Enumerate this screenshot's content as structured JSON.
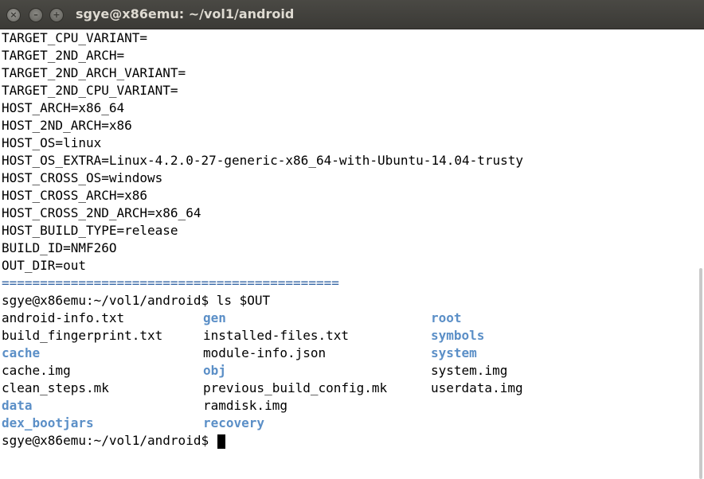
{
  "window": {
    "title": "sgye@x86emu: ~/vol1/android",
    "close_label": "×",
    "minimize_label": "–",
    "maximize_label": "+"
  },
  "terminal": {
    "env_lines": [
      "TARGET_CPU_VARIANT=",
      "TARGET_2ND_ARCH=",
      "TARGET_2ND_ARCH_VARIANT=",
      "TARGET_2ND_CPU_VARIANT=",
      "HOST_ARCH=x86_64",
      "HOST_2ND_ARCH=x86",
      "HOST_OS=linux",
      "HOST_OS_EXTRA=Linux-4.2.0-27-generic-x86_64-with-Ubuntu-14.04-trusty",
      "HOST_CROSS_OS=windows",
      "HOST_CROSS_ARCH=x86",
      "HOST_CROSS_2ND_ARCH=x86_64",
      "HOST_BUILD_TYPE=release",
      "BUILD_ID=NMF26O",
      "OUT_DIR=out"
    ],
    "separator": "============================================",
    "command_line": "sgye@x86emu:~/vol1/android$ ls $OUT",
    "listing": [
      [
        "android-info.txt",
        "gen",
        "root"
      ],
      [
        "build_fingerprint.txt",
        "installed-files.txt",
        "symbols"
      ],
      [
        "cache",
        "module-info.json",
        "system"
      ],
      [
        "cache.img",
        "obj",
        "system.img"
      ],
      [
        "clean_steps.mk",
        "previous_build_config.mk",
        "userdata.img"
      ],
      [
        "data",
        "ramdisk.img",
        ""
      ],
      [
        "dex_bootjars",
        "recovery",
        ""
      ]
    ],
    "listing_is_dir": [
      [
        false,
        true,
        true
      ],
      [
        false,
        false,
        true
      ],
      [
        true,
        false,
        true
      ],
      [
        false,
        true,
        false
      ],
      [
        false,
        false,
        false
      ],
      [
        true,
        false,
        false
      ],
      [
        true,
        true,
        false
      ]
    ],
    "prompt": "sgye@x86emu:~/vol1/android$ ",
    "colors": {
      "directory": "#5b8fc7",
      "separator": "#3465a4",
      "text": "#000000",
      "background": "#ffffff"
    }
  }
}
